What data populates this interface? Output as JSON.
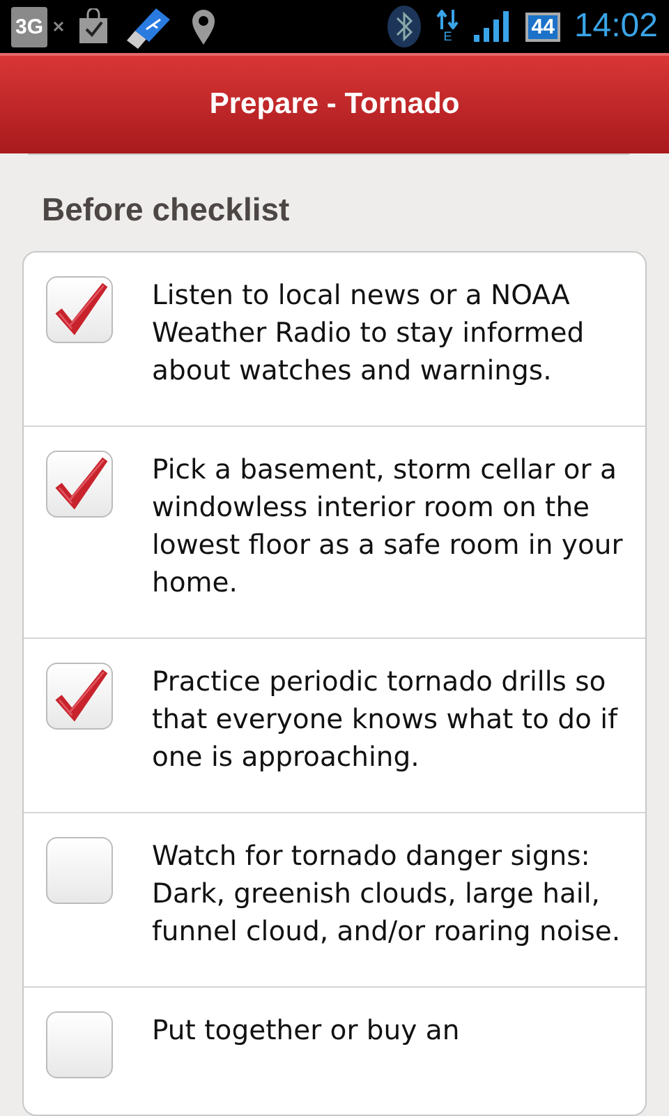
{
  "status_bar": {
    "network": "3G",
    "battery": "44",
    "data": "E",
    "time": "14:02"
  },
  "header": {
    "title": "Prepare - Tornado"
  },
  "section": {
    "title": "Before checklist"
  },
  "items": [
    {
      "text": "Listen to local news or a NOAA Weather Radio to stay informed about watches and warnings.",
      "checked": true
    },
    {
      "text": "Pick a basement, storm cellar or a windowless interior room on the lowest floor as a safe room in your home.",
      "checked": true
    },
    {
      "text": "Practice periodic tornado drills so that everyone knows what to do if one is approaching.",
      "checked": true
    },
    {
      "text": "Watch for tornado danger signs: Dark, greenish clouds, large hail, funnel cloud, and/or roaring noise.",
      "checked": false
    },
    {
      "text": "Put together or buy an",
      "checked": false
    }
  ]
}
